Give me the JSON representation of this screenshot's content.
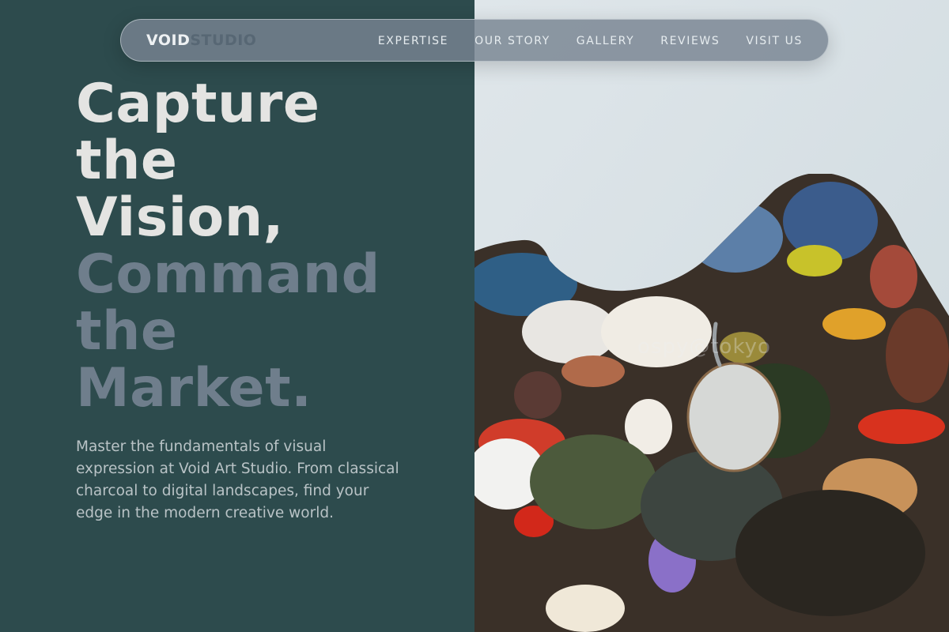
{
  "nav": {
    "brand_main": "VOID",
    "brand_sub": "STUDIO",
    "links": [
      "EXPERTISE",
      "OUR STORY",
      "GALLERY",
      "REVIEWS",
      "VISIT US"
    ]
  },
  "hero": {
    "headline_light": [
      "Capture",
      "the",
      "Vision,"
    ],
    "headline_muted": [
      "Command",
      "the",
      "Market."
    ],
    "description": "Master the fundamentals of visual expression at Void Art Studio. From classical charcoal to digital landscapes, find your edge in the modern creative world."
  },
  "image": {
    "subject": "paint-palette-photo",
    "watermark": "ospy@tokyo"
  },
  "colors": {
    "left_panel": "#2d4b4d",
    "headline_light": "#e4e4e2",
    "headline_muted": "#6f7e8c",
    "nav_bg": "#78848f"
  }
}
